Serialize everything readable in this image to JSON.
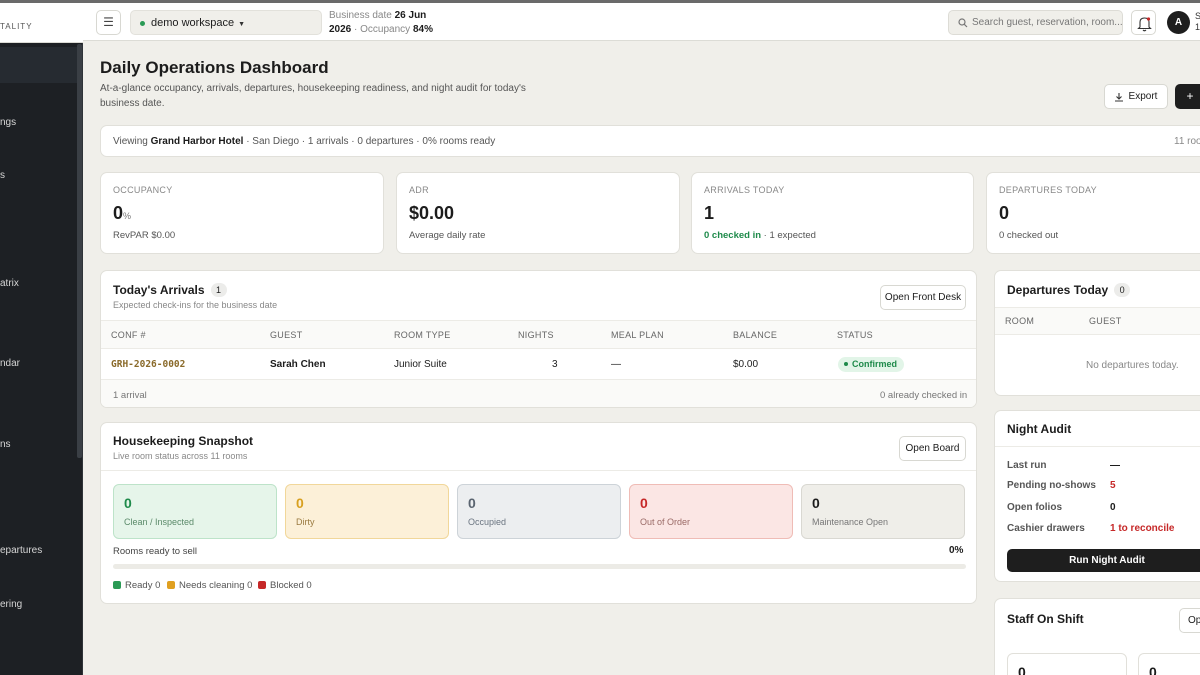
{
  "sidebar": {
    "brand": "TALITY",
    "items": [
      {
        "label": "ngs"
      },
      {
        "label": "s"
      },
      {
        "label": "atrix"
      },
      {
        "label": "ndar"
      },
      {
        "label": "ns"
      },
      {
        "label": "epartures"
      },
      {
        "label": "ering"
      }
    ]
  },
  "topbar": {
    "menu_icon": "☰",
    "workspace": "demo workspace",
    "workspace_caret": "▼",
    "business_date_label": "Business date",
    "business_date_day": "26 Jun",
    "business_date_year": "2026",
    "occupancy_label": "· Occupancy",
    "occupancy_value": "84%",
    "search_placeholder": "Search guest, reservation, room...",
    "avatar_initial": "A",
    "avatar_edge_1": "S",
    "avatar_edge_2": "1"
  },
  "header": {
    "title": "Daily Operations Dashboard",
    "subtitle": "At-a-glance occupancy, arrivals, departures, housekeeping readiness, and night audit for today's business date.",
    "export_label": "Export",
    "add_label": "+"
  },
  "viewing": {
    "prefix": "Viewing",
    "hotel": "Grand Harbor Hotel",
    "details": "· San Diego · 1 arrivals · 0 departures · 0% rooms ready",
    "right": "11 roo"
  },
  "kpis": {
    "occupancy": {
      "label": "OCCUPANCY",
      "value": "0",
      "unit": "%",
      "sub": "RevPAR $0.00"
    },
    "adr": {
      "label": "ADR",
      "value": "$0.00",
      "sub": "Average daily rate"
    },
    "arrivals": {
      "label": "ARRIVALS TODAY",
      "value": "1",
      "sub_green": "0 checked in",
      "sub_rest": "· 1 expected"
    },
    "departures": {
      "label": "DEPARTURES TODAY",
      "value": "0",
      "sub": "0 checked out"
    }
  },
  "arrivals": {
    "title": "Today's Arrivals",
    "count": "1",
    "subtitle": "Expected check-ins for the business date",
    "button": "Open Front Desk",
    "columns": [
      "CONF #",
      "GUEST",
      "ROOM TYPE",
      "NIGHTS",
      "MEAL PLAN",
      "BALANCE",
      "STATUS"
    ],
    "rows": [
      {
        "conf": "GRH-2026-0002",
        "guest": "Sarah Chen",
        "room_type": "Junior Suite",
        "nights": "3",
        "meal_plan": "—",
        "balance": "$0.00",
        "status": "Confirmed"
      }
    ],
    "footer_left": "1 arrival",
    "footer_right": "0 already checked in"
  },
  "housekeeping": {
    "title": "Housekeeping Snapshot",
    "subtitle": "Live room status across 11 rooms",
    "button": "Open Board",
    "tiles": [
      {
        "count": "0",
        "label": "Clean / Inspected"
      },
      {
        "count": "0",
        "label": "Dirty"
      },
      {
        "count": "0",
        "label": "Occupied"
      },
      {
        "count": "0",
        "label": "Out of Order"
      },
      {
        "count": "0",
        "label": "Maintenance Open"
      }
    ],
    "ready_label": "Rooms ready to sell",
    "ready_value": "0%",
    "ready_fraction": 0,
    "legend": [
      {
        "label": "Ready 0",
        "color": "#2a9a55"
      },
      {
        "label": "Needs cleaning 0",
        "color": "#e0a020"
      },
      {
        "label": "Blocked 0",
        "color": "#c62828"
      }
    ]
  },
  "departures_panel": {
    "title": "Departures Today",
    "count": "0",
    "columns": [
      "ROOM",
      "GUEST"
    ],
    "empty": "No departures today."
  },
  "night_audit": {
    "title": "Night Audit",
    "rows": [
      {
        "label": "Last run",
        "value": "—"
      },
      {
        "label": "Pending no-shows",
        "value": "5"
      },
      {
        "label": "Open folios",
        "value": "0"
      },
      {
        "label": "Cashier drawers",
        "value": "1 to reconcile"
      }
    ],
    "button": "Run Night Audit"
  },
  "staff": {
    "title": "Staff On Shift",
    "button": "Op",
    "tiles": [
      "0",
      "0"
    ]
  },
  "colors": {
    "sidebar_bg": "#1d2024",
    "page_bg": "#f0efea",
    "success": "#1e8a4a",
    "danger": "#c62828",
    "primary_dark": "#1e1e1e"
  }
}
